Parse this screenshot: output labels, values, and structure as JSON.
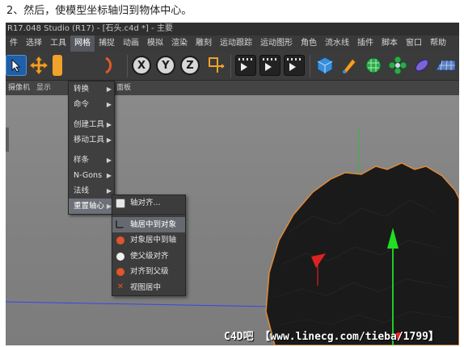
{
  "caption": "2、然后，使模型坐标轴归到物体中心。",
  "window_title": "R17.048 Studio (R17) - [石头.c4d *] - 主要",
  "menubar": [
    "件",
    "选择",
    "工具",
    "网格",
    "捕捉",
    "动画",
    "模拟",
    "渲染",
    "雕刻",
    "运动跟踪",
    "运动图形",
    "角色",
    "流水线",
    "插件",
    "脚本",
    "窗口",
    "帮助"
  ],
  "toolbar": {
    "axis_x": "X",
    "axis_y": "Y",
    "axis_z": "Z"
  },
  "secondbar": {
    "camera": "摄像机",
    "display": "显示",
    "panel": "面板"
  },
  "mesh_menu": [
    {
      "label": "转换",
      "has_sub": true
    },
    {
      "label": "命令",
      "has_sub": true
    },
    {
      "label": "创建工具",
      "has_sub": true
    },
    {
      "label": "移动工具",
      "has_sub": true
    },
    {
      "label": "样条",
      "has_sub": true
    },
    {
      "label": "N-Gons",
      "has_sub": true
    },
    {
      "label": "法线",
      "has_sub": true
    },
    {
      "label": "重置轴心",
      "has_sub": true,
      "selected": true
    }
  ],
  "axis_submenu": {
    "header": "轴对齐...",
    "items": [
      {
        "label": "轴居中到对象",
        "selected": true,
        "icon": "axis-center-icon"
      },
      {
        "label": "对象居中到轴",
        "icon": "object-center-icon"
      },
      {
        "label": "使父级对齐",
        "icon": "parent-align-icon"
      },
      {
        "label": "对齐到父级",
        "icon": "align-to-parent-icon"
      },
      {
        "label": "视图居中",
        "icon": "view-center-icon"
      }
    ]
  },
  "watermark": "C4D吧 【www.linecg.com/tieba/1799】",
  "colors": {
    "menu_bg": "#3f3f3f",
    "menu_selected": "#6d7078",
    "viewport_bg": "#808080",
    "object_outline": "#e08a3a",
    "axis_y": "#22cc22",
    "axis_x": "#dd2222",
    "axis_z": "#2a3cff"
  }
}
